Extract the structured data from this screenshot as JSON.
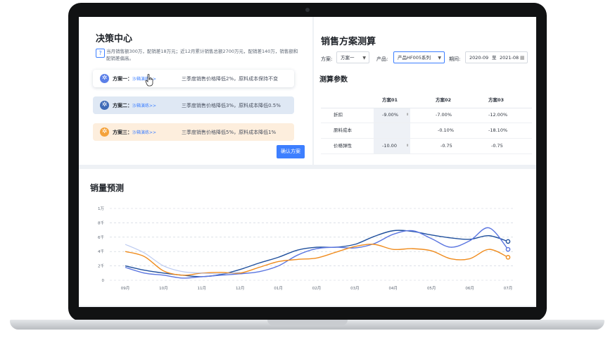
{
  "decision": {
    "title": "决策中心",
    "summary": "当月销售额300万，配销差18万元；近12月累计销售总额2700万元，配销差140万，销售额和配销差偏高。",
    "plans": [
      {
        "name": "方案一：",
        "link": "沙箱演练>>",
        "desc": "三季度销售价格降低2%，原料成本保持不变",
        "color": "#5b7fe8",
        "icon_name": "plan-icon"
      },
      {
        "name": "方案二：",
        "link": "沙箱演练>>",
        "desc": "三季度销售价格降低3%，原料成本降低0.5%",
        "color": "#3e6bb8",
        "icon_name": "plan-icon"
      },
      {
        "name": "方案三：",
        "link": "沙箱演练>>",
        "desc": "三季度销售价格降低5%，原料成本降低1%",
        "color": "#f4a23b",
        "icon_name": "plan-icon"
      }
    ],
    "confirm_label": "确认方案"
  },
  "calc": {
    "title": "销售方案测算",
    "filters": {
      "plan_label": "方案:",
      "plan_value": "方案一",
      "product_label": "产品:",
      "product_value": "产品HF005系列",
      "period_label": "期间:",
      "date_start": "2020-09",
      "date_sep": "至",
      "date_end": "2021-08"
    },
    "params_title": "测算参数",
    "columns": [
      "方案01",
      "方案02",
      "方案03"
    ],
    "rows": [
      {
        "label": "折扣",
        "values": [
          "-9.00%",
          "-7.00%",
          "-12.00%"
        ]
      },
      {
        "label": "原料成本",
        "values": [
          "",
          "-0.10%",
          "-18.10%"
        ]
      },
      {
        "label": "价格弹性",
        "values": [
          "-10.00",
          "-0.75",
          "-0.75"
        ]
      }
    ]
  },
  "forecast": {
    "title": "销量预测"
  },
  "chart_data": {
    "type": "line",
    "x": [
      "09月",
      "10月",
      "11月",
      "12月",
      "01月",
      "02月",
      "03月",
      "04月",
      "05月",
      "06月",
      "07月"
    ],
    "y_ticks": [
      "0",
      "2千",
      "4千",
      "6千",
      "8千",
      "1万"
    ],
    "ylim": [
      0,
      10000
    ],
    "grid": true,
    "series": [
      {
        "color": "#1f4f9c",
        "points": [
          [
            0,
            2000
          ],
          [
            0.5,
            1400
          ],
          [
            1,
            1000
          ],
          [
            1.5,
            700
          ],
          [
            2,
            500
          ],
          [
            2.5,
            800
          ],
          [
            3,
            1500
          ],
          [
            3.5,
            2400
          ],
          [
            4,
            3200
          ],
          [
            4.5,
            4200
          ],
          [
            5,
            4600
          ],
          [
            5.5,
            4600
          ],
          [
            6,
            5000
          ],
          [
            6.5,
            6100
          ],
          [
            7,
            6900
          ],
          [
            7.5,
            6800
          ],
          [
            8,
            6300
          ],
          [
            8.5,
            5900
          ],
          [
            9,
            5700
          ],
          [
            9.5,
            6200
          ],
          [
            10,
            5400
          ]
        ]
      },
      {
        "color": "#5a75e0",
        "points": [
          [
            0,
            1800
          ],
          [
            0.5,
            1000
          ],
          [
            1,
            700
          ],
          [
            1.5,
            300
          ],
          [
            2,
            500
          ],
          [
            2.5,
            700
          ],
          [
            3,
            900
          ],
          [
            3.5,
            1200
          ],
          [
            4,
            2000
          ],
          [
            4.5,
            3500
          ],
          [
            5,
            4400
          ],
          [
            5.5,
            4600
          ],
          [
            6,
            4500
          ],
          [
            6.5,
            5100
          ],
          [
            7,
            6400
          ],
          [
            7.5,
            6900
          ],
          [
            8,
            5800
          ],
          [
            8.5,
            4600
          ],
          [
            9,
            5500
          ],
          [
            9.5,
            7300
          ],
          [
            10,
            4300
          ]
        ]
      },
      {
        "color": "#f08c1e",
        "points": [
          [
            0,
            4000
          ],
          [
            0.5,
            3300
          ],
          [
            1,
            1300
          ],
          [
            1.5,
            700
          ],
          [
            2,
            1000
          ],
          [
            2.5,
            1100
          ],
          [
            3,
            1000
          ],
          [
            3.5,
            1800
          ],
          [
            4,
            2600
          ],
          [
            4.5,
            2900
          ],
          [
            5,
            3100
          ],
          [
            5.5,
            3900
          ],
          [
            6,
            4700
          ],
          [
            6.5,
            5000
          ],
          [
            7,
            4300
          ],
          [
            7.5,
            4400
          ],
          [
            8,
            4100
          ],
          [
            8.5,
            3000
          ],
          [
            9,
            3000
          ],
          [
            9.5,
            4300
          ],
          [
            10,
            3200
          ]
        ]
      },
      {
        "color": "#9fb3ea",
        "points": [
          [
            0,
            5000
          ],
          [
            0.5,
            3800
          ],
          [
            1,
            2000
          ],
          [
            1.5,
            1200
          ],
          [
            2,
            1000
          ],
          [
            2.5,
            900
          ],
          [
            3,
            1100
          ]
        ]
      }
    ]
  }
}
